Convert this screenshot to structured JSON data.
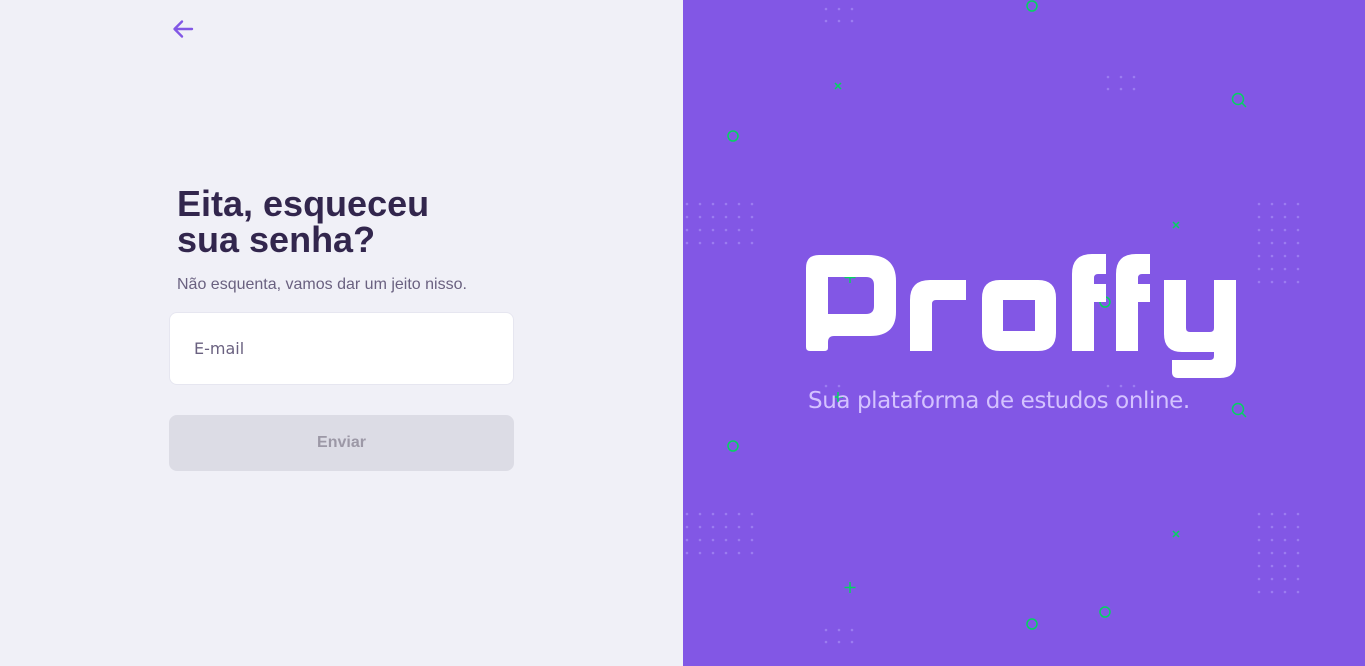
{
  "page": {
    "title": "Eita, esqueceu sua senha?",
    "subtitle": "Não esquenta, vamos dar um jeito nisso."
  },
  "form": {
    "email_placeholder": "E-mail",
    "email_value": "",
    "submit_label": "Enviar"
  },
  "brand": {
    "name": "Proffy",
    "tagline": "Sua plataforma de estudos online."
  },
  "icons": {
    "back": "arrow-left-icon"
  },
  "colors": {
    "primary": "#8257e5",
    "background": "#f0f0f7",
    "title_text": "#32264d",
    "body_text": "#6a6180",
    "button_disabled_bg": "#dcdce5",
    "button_disabled_text": "#9c98a6",
    "accent_green": "#04d361",
    "tagline_text": "#d4c2ff"
  }
}
